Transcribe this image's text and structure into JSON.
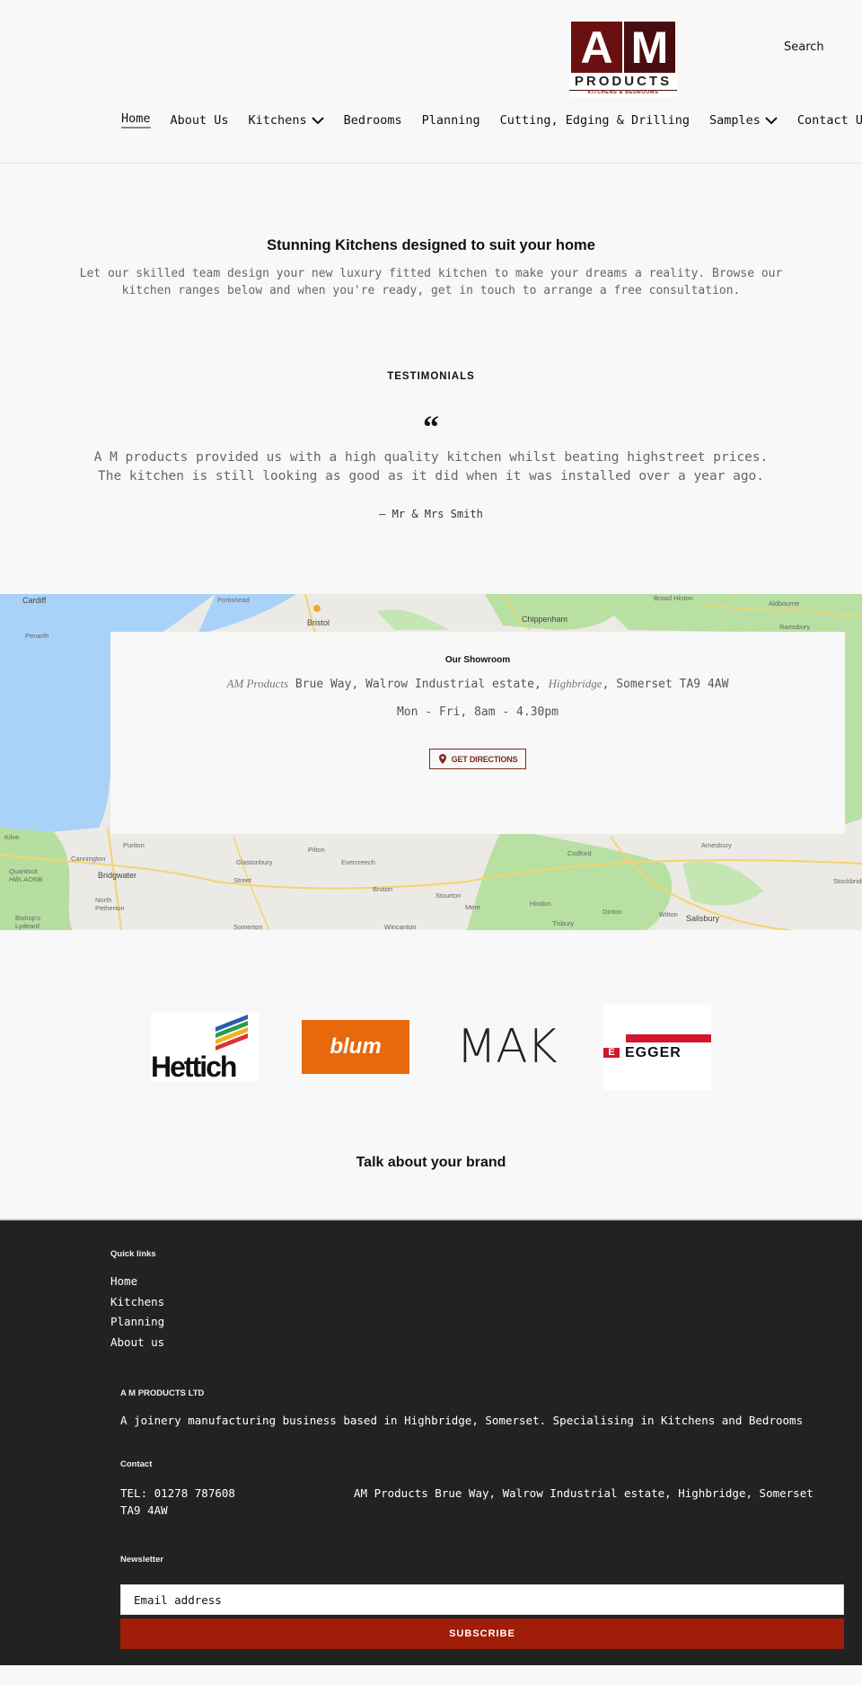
{
  "header": {
    "logo": {
      "letter_a": "A",
      "letter_m": "M",
      "products": "PRODUCTS",
      "subtitle": "KITCHENS & BEDROOMS",
      "colors": {
        "a_block": "#6a1010",
        "m_block": "#4a0d0d"
      }
    },
    "search_label": "Search",
    "nav": [
      {
        "label": "Home",
        "active": true,
        "dropdown": false
      },
      {
        "label": "About Us",
        "dropdown": false
      },
      {
        "label": "Kitchens",
        "dropdown": true,
        "icon": "chevron-down-icon"
      },
      {
        "label": "Bedrooms",
        "dropdown": false
      },
      {
        "label": "Planning",
        "dropdown": false
      },
      {
        "label": "Cutting, Edging & Drilling",
        "dropdown": false
      },
      {
        "label": "Samples",
        "dropdown": true,
        "icon": "chevron-down-icon"
      },
      {
        "label": "Contact Us",
        "dropdown": false
      }
    ]
  },
  "intro": {
    "title": "Stunning Kitchens designed to suit your home",
    "text": "Let our skilled team design your new luxury fitted kitchen to make your dreams a reality. Browse our kitchen ranges below and when you're ready, get in touch to arrange a free consultation."
  },
  "testimonials": {
    "heading": "TESTIMONIALS",
    "quote_icon": "“",
    "quote": "A M products provided us with a high quality kitchen whilst beating highstreet prices. The kitchen is still looking as good as it did when it was installed over a year ago.",
    "author": "— Mr & Mrs Smith"
  },
  "map": {
    "places": [
      "Cardiff",
      "Penarth",
      "Portishead",
      "Bristol",
      "Chippenham",
      "Broad Hinton",
      "Aldbourne",
      "Ramsbury",
      "Kilve",
      "Puriton",
      "Cannington",
      "Bridgwater",
      "Quantock Hills AONB",
      "North Petherton",
      "Bishop's Lydeard",
      "Glastonbury",
      "Street",
      "Pilton",
      "Evercreech",
      "Bruton",
      "Somerton",
      "Wincanton",
      "Stourton",
      "Mere",
      "Hindon",
      "Tisbury",
      "Dinton",
      "Codford",
      "Wilton",
      "Salisbury",
      "Amesbury",
      "Stockbridge"
    ],
    "showroom": {
      "heading": "Our Showroom",
      "address_name": "AM Products",
      "address_part1": " Brue Way, Walrow Industrial estate, ",
      "address_town": "Highbridge",
      "address_part2": ", Somerset TA9 4AW",
      "hours": "Mon - Fri, 8am - 4.30pm",
      "directions_label": "GET DIRECTIONS",
      "directions_icon": "map-pin-icon",
      "accent": "#7a2a20"
    }
  },
  "brands": {
    "logos": [
      {
        "name": "Hettich",
        "text": "Hettich",
        "stripe_colors": [
          "#2a5db0",
          "#2f9a47",
          "#f2b21b",
          "#e0322e"
        ]
      },
      {
        "name": "blum",
        "text": "blum",
        "bg": "#e8690c"
      },
      {
        "name": "MAK",
        "text": "MAK"
      },
      {
        "name": "EGGER",
        "text": "EGGER",
        "accent": "#d5152c"
      }
    ],
    "tagline": "Talk about your brand"
  },
  "footer": {
    "quick_links_heading": "Quick links",
    "quick_links": [
      "Home",
      "Kitchens",
      "Planning",
      "About us"
    ],
    "company_heading": "A M PRODUCTS LTD",
    "company_text": "A joinery manufacturing business based in Highbridge, Somerset. Specialising in Kitchens and Bedrooms",
    "contact_heading": "Contact",
    "tel": "TEL: 01278 787608",
    "address": "AM Products Brue Way, Walrow Industrial estate, Highbridge, Somerset TA9 4AW",
    "newsletter_heading": "Newsletter",
    "email_placeholder": "Email address",
    "subscribe_label": "SUBSCRIBE",
    "subscribe_color": "#a01d09"
  }
}
